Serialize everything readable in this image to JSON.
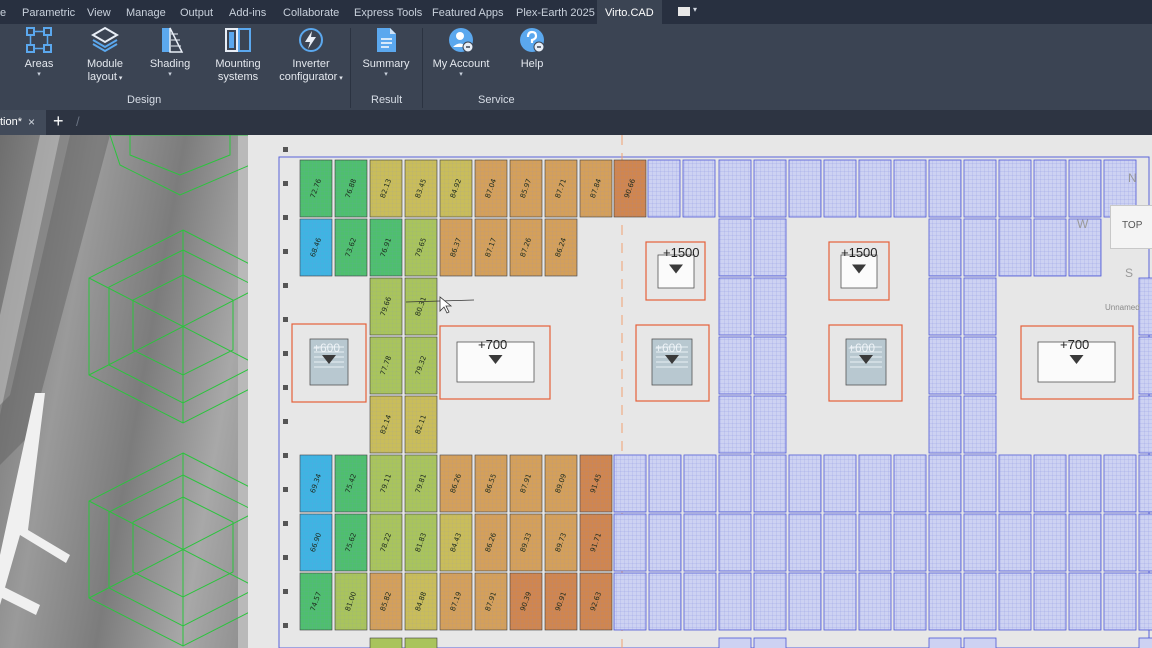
{
  "menubar": {
    "tabs": [
      "e",
      "Parametric",
      "View",
      "Manage",
      "Output",
      "Add-ins",
      "Collaborate",
      "Express Tools",
      "Featured Apps",
      "Plex-Earth 2025",
      "Virto.CAD"
    ],
    "active_tab": "Virto.CAD"
  },
  "ribbon": {
    "buttons": {
      "areas": "Areas",
      "module_layout_1": "Module",
      "module_layout_2": "layout",
      "shading": "Shading",
      "mounting_1": "Mounting",
      "mounting_2": "systems",
      "inverter_1": "Inverter",
      "inverter_2": "configurator",
      "summary": "Summary",
      "my_account": "My Account",
      "help": "Help"
    },
    "groups": {
      "design": "Design",
      "result": "Result",
      "service": "Service"
    }
  },
  "document_tab": {
    "title": "tion*",
    "close": "×",
    "new": "+"
  },
  "drawing": {
    "elevations": {
      "e1500a": "+1500",
      "e1500b": "+1500",
      "e700a": "+700",
      "e700b": "+700",
      "e600a": "+600",
      "e600b": "+600",
      "e600c": "+600"
    },
    "viewcube": {
      "top": "TOP",
      "north": "N",
      "west": "W",
      "south": "S",
      "label": "Unnamed"
    },
    "panel_values": {
      "top_row1": [
        "72.76",
        "76.88",
        "82.13",
        "83.45",
        "84.92",
        "87.04",
        "85.97",
        "87.71",
        "87.84",
        "90.66"
      ],
      "top_row2": [
        "68.46",
        "73.62",
        "76.91",
        "79.65",
        "86.37",
        "87.17",
        "87.26",
        "86.24"
      ],
      "mid_row3": [
        "79.66",
        "80.31"
      ],
      "mid_row4": [
        "77.78",
        "79.32"
      ],
      "mid_row5": [
        "82.14",
        "82.11"
      ],
      "bot_row1": [
        "69.34",
        "75.42",
        "79.11",
        "79.81",
        "86.26",
        "86.55",
        "87.91",
        "89.09",
        "91.45"
      ],
      "bot_row2": [
        "66.90",
        "75.62",
        "78.22",
        "81.83",
        "84.43",
        "86.26",
        "89.33",
        "89.73",
        "91.71"
      ],
      "bot_row3": [
        "74.57",
        "81.00",
        "85.82",
        "84.88",
        "87.19",
        "87.91",
        "90.39",
        "90.91",
        "92.63"
      ]
    },
    "colors": {
      "blue": "#3fb4e2",
      "green": "#4fbf6e",
      "yellowgreen": "#a9c45c",
      "yellow": "#c9bd5a",
      "orange": "#d4a05a",
      "deep_orange": "#d0864f",
      "unshaded_panel": "#cdd2f2",
      "obstacle_outline": "#e5603a"
    }
  }
}
